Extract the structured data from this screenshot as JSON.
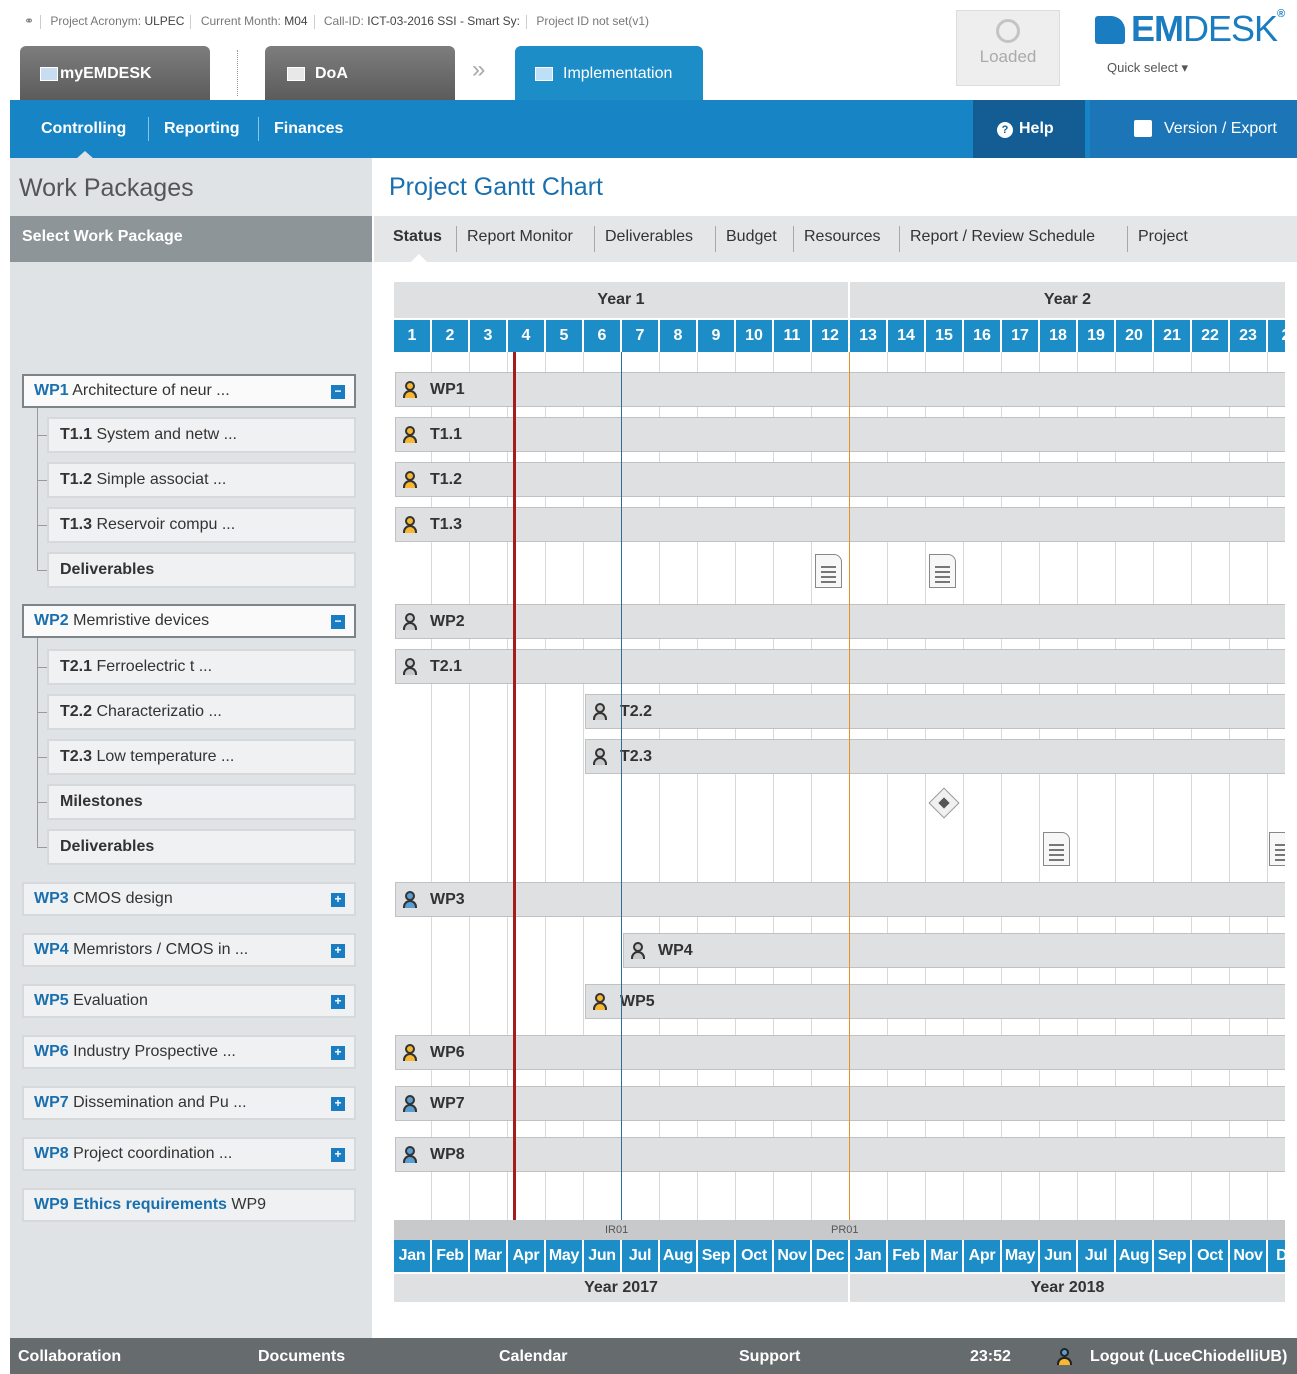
{
  "header": {
    "link_icon": "link-icon",
    "acronym_label": "Project Acronym:",
    "acronym": "ULPEC",
    "month_label": "Current Month:",
    "month": "M04",
    "callid_label": "Call-ID:",
    "callid": "ICT-03-2016 SSI - Smart Sy:",
    "project_id": "Project ID not set(v1)",
    "tabs": [
      "myEMDESK",
      "DoA",
      "Implementation"
    ],
    "loaded": "Loaded",
    "logo_bold": "EM",
    "logo_light": "DESK",
    "logo_reg": "®",
    "quick_select": "Quick select"
  },
  "nav": {
    "items": [
      "Controlling",
      "Reporting",
      "Finances"
    ],
    "help": "Help",
    "version": "Version / Export"
  },
  "sidebar": {
    "title": "Work Packages",
    "select_label": "Select Work Package",
    "wp1": {
      "code": "WP1",
      "name": "Architecture of neur ..."
    },
    "t11": {
      "code": "T1.1",
      "name": "System and netw ..."
    },
    "t12": {
      "code": "T1.2",
      "name": "Simple associat ..."
    },
    "t13": {
      "code": "T1.3",
      "name": "Reservoir compu ..."
    },
    "d1": "Deliverables",
    "wp2": {
      "code": "WP2",
      "name": "Memristive devices"
    },
    "t21": {
      "code": "T2.1",
      "name": "Ferroelectric t ..."
    },
    "t22": {
      "code": "T2.2",
      "name": "Characterizatio ..."
    },
    "t23": {
      "code": "T2.3",
      "name": "Low temperature ..."
    },
    "m2": "Milestones",
    "d2": "Deliverables",
    "wp3": {
      "code": "WP3",
      "name": "CMOS design"
    },
    "wp4": {
      "code": "WP4",
      "name": "Memristors / CMOS in ..."
    },
    "wp5": {
      "code": "WP5",
      "name": "Evaluation"
    },
    "wp6": {
      "code": "WP6",
      "name": "Industry Prospective ..."
    },
    "wp7": {
      "code": "WP7",
      "name": "Dissemination and Pu ..."
    },
    "wp8": {
      "code": "WP8",
      "name": "Project coordination ..."
    },
    "wp9": {
      "code": "WP9",
      "name": "Ethics requirements",
      "suffix": "WP9"
    },
    "minus": "−",
    "plus": "+"
  },
  "main": {
    "title": "Project Gantt Chart",
    "subtabs": [
      "Status",
      "Report Monitor",
      "Deliverables",
      "Budget",
      "Resources",
      "Report / Review Schedule",
      "Project"
    ]
  },
  "gantt": {
    "years": [
      "Year 1",
      "Year 2"
    ],
    "months": [
      "1",
      "2",
      "3",
      "4",
      "5",
      "6",
      "7",
      "8",
      "9",
      "10",
      "11",
      "12",
      "13",
      "14",
      "15",
      "16",
      "17",
      "18",
      "19",
      "20",
      "21",
      "22",
      "23",
      "2"
    ],
    "month_names": [
      "Jan",
      "Feb",
      "Mar",
      "Apr",
      "May",
      "Jun",
      "Jul",
      "Aug",
      "Sep",
      "Oct",
      "Nov",
      "Dec",
      "Jan",
      "Feb",
      "Mar",
      "Apr",
      "May",
      "Jun",
      "Jul",
      "Aug",
      "Sep",
      "Oct",
      "Nov",
      "De"
    ],
    "cal_years": [
      "Year 2017",
      "Year 2018"
    ],
    "markers": [
      "IR01",
      "PR01"
    ],
    "rows": {
      "wp1": "WP1",
      "t11": "T1.1",
      "t12": "T1.2",
      "t13": "T1.3",
      "wp2": "WP2",
      "t21": "T2.1",
      "t22": "T2.2",
      "t23": "T2.3",
      "wp3": "WP3",
      "wp4": "WP4",
      "wp5": "WP5",
      "wp6": "WP6",
      "wp7": "WP7",
      "wp8": "WP8"
    }
  },
  "footer": {
    "items": [
      "Collaboration",
      "Documents",
      "Calendar",
      "Support"
    ],
    "time": "23:52",
    "logout": "Logout (LuceChiodelliUB)"
  }
}
